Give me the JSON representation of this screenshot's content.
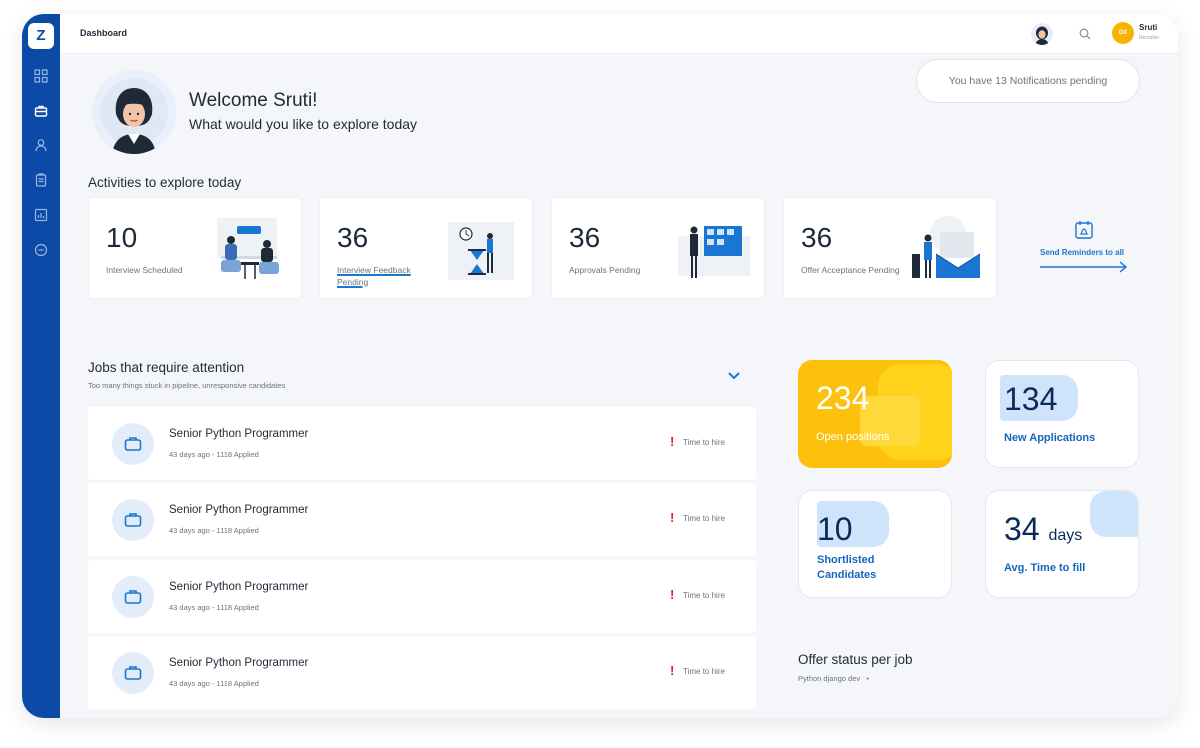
{
  "header": {
    "breadcrumb": "Dashboard",
    "user": {
      "initials": "DX",
      "name": "Sruti",
      "role": "Recruiter"
    },
    "notification": "You have 13 Notifications pending"
  },
  "sidebar": {
    "logo": "Z",
    "items": [
      {
        "icon": "grid-icon"
      },
      {
        "icon": "briefcase-icon"
      },
      {
        "icon": "user-icon"
      },
      {
        "icon": "clipboard-icon"
      },
      {
        "icon": "chart-icon"
      },
      {
        "icon": "more-icon"
      }
    ]
  },
  "welcome": {
    "title": "Welcome Sruti!",
    "subtitle": "What would you like to explore today"
  },
  "activities": {
    "title": "Activities to explore today",
    "cards": [
      {
        "count": "10",
        "label": "Interview Scheduled"
      },
      {
        "count": "36",
        "label": "Interview Feedback Pending"
      },
      {
        "count": "36",
        "label": "Approvals Pending"
      },
      {
        "count": "36",
        "label": "Offer Acceptance Pending"
      }
    ],
    "reminder_label": "Send Reminders to all"
  },
  "jobs": {
    "title": "Jobs that require attention",
    "subtitle": "Too many things stuck in pipeline, unresponsive candidates",
    "rows": [
      {
        "title": "Senior Python Programmer",
        "meta": "43 days ago - 1118 Applied",
        "tag": "Time to hire"
      },
      {
        "title": "Senior Python Programmer",
        "meta": "43 days ago - 1118 Applied",
        "tag": "Time to hire"
      },
      {
        "title": "Senior Python Programmer",
        "meta": "43 days ago - 1118 Applied",
        "tag": "Time to hire"
      },
      {
        "title": "Senior Python Programmer",
        "meta": "43 days ago - 1118 Applied",
        "tag": "Time to hire"
      }
    ],
    "alert_symbol": "!"
  },
  "stats": {
    "open_positions": {
      "value": "234",
      "label": "Open positions"
    },
    "new_applications": {
      "value": "134",
      "label": "New Applications"
    },
    "shortlisted": {
      "value": "10",
      "label": "Shortlisted Candidates"
    },
    "time_to_fill": {
      "value": "34",
      "unit": "days",
      "label": "Avg. Time to fill"
    }
  },
  "offer_status": {
    "title": "Offer status per job",
    "selected_job": "Python django dev"
  },
  "colors": {
    "sidebar": "#0b4aa6",
    "accent": "#1976d2",
    "highlight": "#fcc10c",
    "alert": "#e02424"
  }
}
